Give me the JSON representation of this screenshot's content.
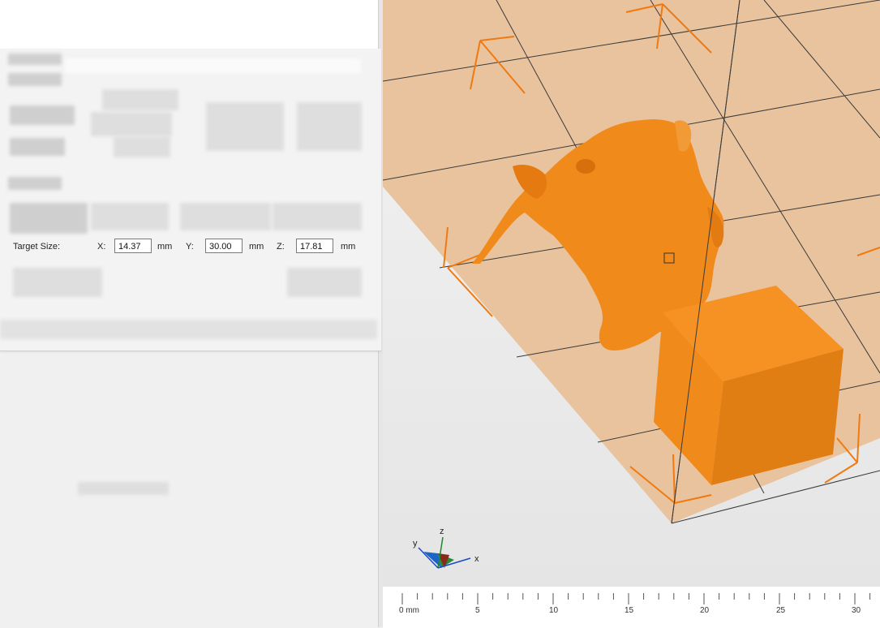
{
  "target_size": {
    "label": "Target Size:",
    "x_label": "X:",
    "x_value": "14.37",
    "y_label": "Y:",
    "y_value": "30.00",
    "z_label": "Z:",
    "z_value": "17.81",
    "unit": "mm"
  },
  "axis_gizmo": {
    "x": "x",
    "y": "y",
    "z": "z"
  },
  "ruler": {
    "labels": [
      "0 mm",
      "5",
      "10",
      "15",
      "20",
      "25",
      "30"
    ]
  },
  "colors": {
    "model": "#f08a1a",
    "bed": "#e8c39e",
    "bounding_box": "#f07a10",
    "grid_line": "#333333"
  }
}
